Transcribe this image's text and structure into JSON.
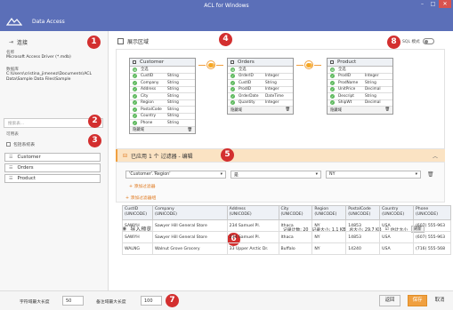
{
  "window": {
    "title": "ACL for Windows"
  },
  "app": {
    "title": "Data Access"
  },
  "sidebar": {
    "connection_label": "连接",
    "name_label": "名称",
    "name_value": "Microsoft Access Driver (*.mdb)",
    "db_label": "数据库",
    "db_value": "C:\\Users\\cristina_jimenez\\Documents\\ACL Data\\Sample Data Files\\Sample",
    "search_placeholder": "搜索表...",
    "tables_label": "可用表",
    "include_system": "包括系统表",
    "tables": [
      "Customer",
      "Orders",
      "Product"
    ]
  },
  "main": {
    "display_area": "展示区域",
    "sql_mode": "SQL 模式",
    "select_all": "全选",
    "hide_fields": "隐藏域",
    "table_boxes": [
      {
        "name": "Customer",
        "fields": [
          {
            "name": "CustID",
            "type": "String"
          },
          {
            "name": "Company",
            "type": "String"
          },
          {
            "name": "Address",
            "type": "String"
          },
          {
            "name": "City",
            "type": "String"
          },
          {
            "name": "Region",
            "type": "String"
          },
          {
            "name": "PostalCode",
            "type": "String"
          },
          {
            "name": "Country",
            "type": "String"
          },
          {
            "name": "Phone",
            "type": "String"
          }
        ]
      },
      {
        "name": "Orders",
        "fields": [
          {
            "name": "OrderID",
            "type": "Integer"
          },
          {
            "name": "CustID",
            "type": "String"
          },
          {
            "name": "ProdID",
            "type": "Integer"
          },
          {
            "name": "OrderDate",
            "type": "DateTime"
          },
          {
            "name": "Quantity",
            "type": "Integer"
          }
        ]
      },
      {
        "name": "Product",
        "fields": [
          {
            "name": "ProdID",
            "type": "Integer"
          },
          {
            "name": "ProdName",
            "type": "String"
          },
          {
            "name": "UnitPrice",
            "type": "Decimal"
          },
          {
            "name": "Descript",
            "type": "String"
          },
          {
            "name": "ShipWt",
            "type": "Decimal"
          }
        ]
      }
    ],
    "filter": {
      "header": "已应用 1 个 过滤器 - 编辑",
      "field": "'Customer'.'Region'",
      "operator": "是",
      "value": "NY",
      "add_filter": "+ 添加过滤器",
      "add_group": "+ 添加过滤器组"
    },
    "preview": {
      "title": "导入预览",
      "record_count": "记录计数: 20",
      "record_size": "记录大小: 1.1 KB",
      "total_size": "总大小: 29.7 KB",
      "estimate": "估计大小",
      "refresh": "刷新",
      "columns": [
        {
          "name": "CustID",
          "type": "(UNICODE)"
        },
        {
          "name": "Company",
          "type": "(UNICODE)"
        },
        {
          "name": "Address",
          "type": "(UNICODE)"
        },
        {
          "name": "City",
          "type": "(UNICODE)"
        },
        {
          "name": "Region",
          "type": "(UNICODE)"
        },
        {
          "name": "PostalCode",
          "type": "(UNICODE)"
        },
        {
          "name": "Country",
          "type": "(UNICODE)"
        },
        {
          "name": "Phone",
          "type": "(UNICODE)"
        }
      ],
      "rows": [
        [
          "SAWYH",
          "Sawyer Hill General Store",
          "234 Samuel Pl.",
          "Ithaca",
          "NY",
          "14853",
          "USA",
          "(607) 555-963"
        ],
        [
          "SAWYH",
          "Sawyer Hill General Store",
          "234 Samuel Pl.",
          "Ithaca",
          "NY",
          "14853",
          "USA",
          "(607) 555-963"
        ],
        [
          "WALNG",
          "Walnut Grove Grocery",
          "33 Upper Arctic Dr.",
          "Buffalo",
          "NY",
          "14240",
          "USA",
          "(716) 555-568"
        ]
      ]
    }
  },
  "footer": {
    "char_len_label": "字符域最大长度",
    "char_len_value": "50",
    "memo_len_label": "备注域最大长度",
    "memo_len_value": "100",
    "back": "返回",
    "save": "保存",
    "cancel": "取消"
  },
  "badges": [
    "1",
    "2",
    "3",
    "4",
    "5",
    "6",
    "7",
    "8"
  ],
  "colors": {
    "titlebar": "#5b6fb8",
    "accent": "#f0a040",
    "badge": "#d32f2f",
    "key_field": "#5cb85c"
  }
}
